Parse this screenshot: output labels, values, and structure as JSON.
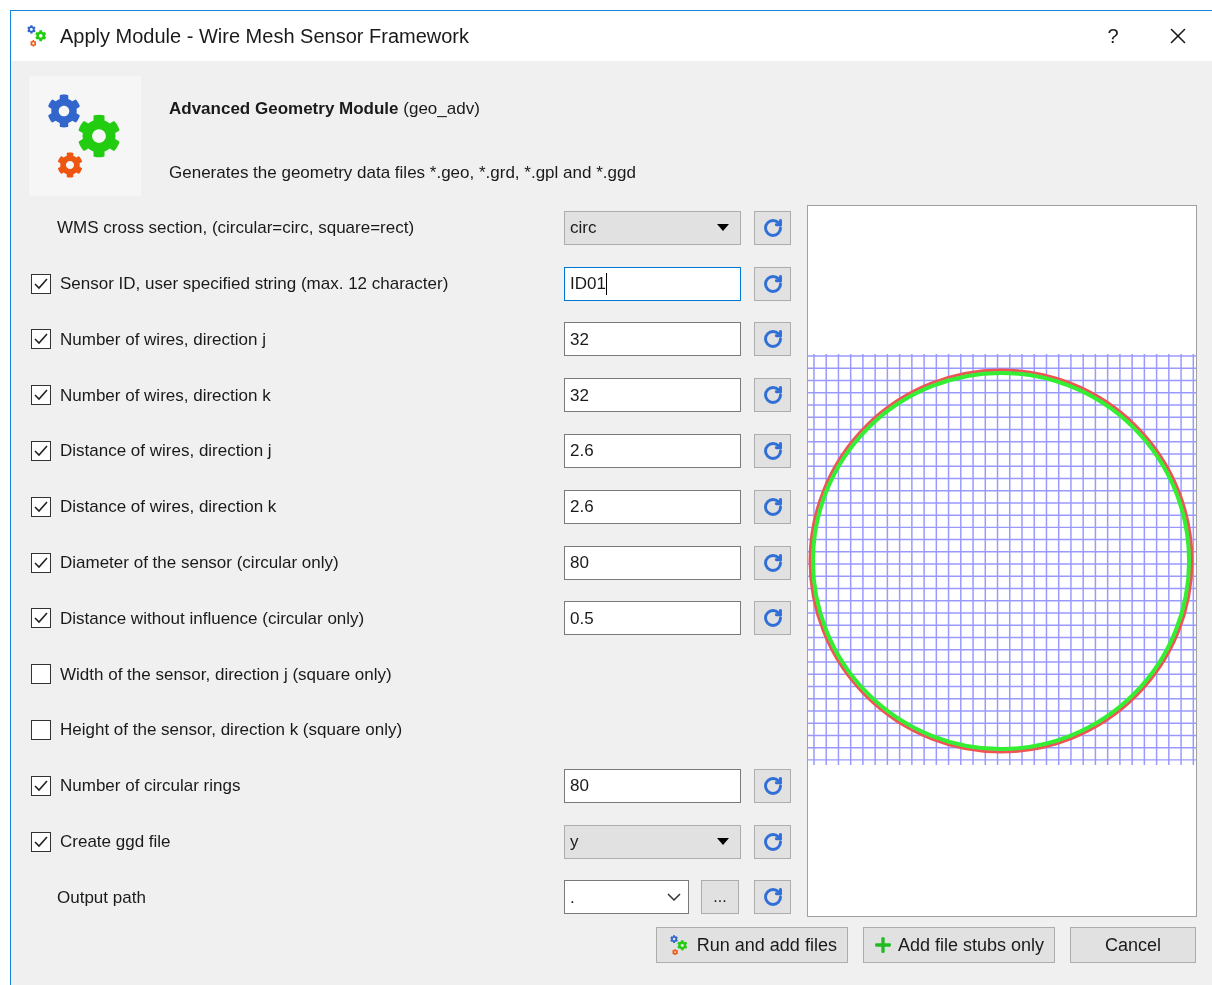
{
  "window": {
    "title": "Apply Module - Wire Mesh Sensor Framework",
    "help": "?"
  },
  "module": {
    "heading": "**Advanced Geometry Module** (geo_adv)",
    "description": "Generates the geometry data files *.geo, *.grd, *.gpl and *.ggd"
  },
  "rows": [
    {
      "label": "WMS cross section, (circular=circ, square=rect)",
      "kind": "dropdown",
      "value": "circ"
    },
    {
      "label": "Sensor ID, user specified string (max. 12 character)",
      "checked": true,
      "kind": "text",
      "value": "ID01",
      "focused": true
    },
    {
      "label": "Number of wires, direction j",
      "checked": true,
      "kind": "text",
      "value": "32"
    },
    {
      "label": "Number of wires, direction k",
      "checked": true,
      "kind": "text",
      "value": "32"
    },
    {
      "label": "Distance of wires, direction j",
      "checked": true,
      "kind": "text",
      "value": "2.6"
    },
    {
      "label": "Distance of wires, direction k",
      "checked": true,
      "kind": "text",
      "value": "2.6"
    },
    {
      "label": "Diameter of the sensor (circular only)",
      "checked": true,
      "kind": "text",
      "value": "80"
    },
    {
      "label": "Distance without influence (circular only)",
      "checked": true,
      "kind": "text",
      "value": "0.5"
    },
    {
      "label": "Width of the sensor, direction j (square only)",
      "checked": false,
      "kind": "none"
    },
    {
      "label": "Height of the sensor, direction k (square only)",
      "checked": false,
      "kind": "none"
    },
    {
      "label": "Number of circular rings",
      "checked": true,
      "kind": "text",
      "value": "80"
    },
    {
      "label": "Create ggd file",
      "checked": true,
      "kind": "dropdown",
      "value": "y"
    },
    {
      "label": "Output path",
      "kind": "path",
      "value": ".",
      "browse": "..."
    }
  ],
  "buttons": [
    {
      "label": "Run and add files",
      "kind": "run"
    },
    {
      "label": "Add file stubs only",
      "kind": "add"
    },
    {
      "label": "Cancel",
      "kind": "plain"
    }
  ]
}
